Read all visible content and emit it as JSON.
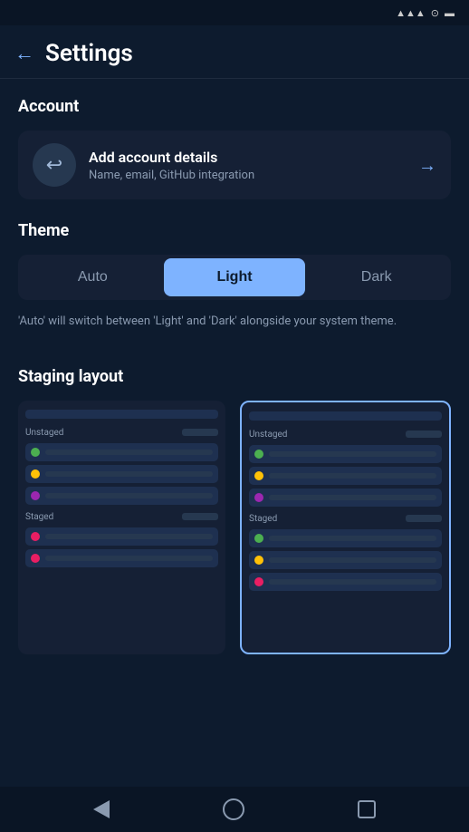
{
  "statusBar": {
    "batteryIcon": "battery-icon",
    "signalIcon": "signal-icon"
  },
  "header": {
    "backLabel": "←",
    "title": "Settings"
  },
  "account": {
    "sectionTitle": "Account",
    "card": {
      "title": "Add account details",
      "subtitle": "Name, email, GitHub integration",
      "arrow": "→"
    }
  },
  "theme": {
    "sectionTitle": "Theme",
    "options": [
      {
        "id": "auto",
        "label": "Auto",
        "active": false
      },
      {
        "id": "light",
        "label": "Light",
        "active": true
      },
      {
        "id": "dark",
        "label": "Dark",
        "active": false
      }
    ],
    "note": "'Auto' will switch between 'Light' and 'Dark' alongside your system theme."
  },
  "stagingLayout": {
    "sectionTitle": "Staging layout",
    "layouts": [
      {
        "id": "layout-1",
        "selected": false,
        "unstagedLabel": "Unstaged",
        "files": [
          {
            "color": "green"
          },
          {
            "color": "yellow"
          },
          {
            "color": "purple"
          }
        ],
        "stagedLabel": "Staged",
        "stagedFiles": [
          {
            "color": "pink"
          },
          {
            "color": "pink"
          }
        ]
      },
      {
        "id": "layout-2",
        "selected": true,
        "unstagedLabel": "Unstaged",
        "files": [
          {
            "color": "green"
          },
          {
            "color": "yellow"
          },
          {
            "color": "purple"
          }
        ],
        "stagedLabel": "Staged",
        "stagedFiles": [
          {
            "color": "green"
          },
          {
            "color": "yellow"
          },
          {
            "color": "pink"
          }
        ]
      }
    ]
  },
  "bottomNav": {
    "items": [
      "back",
      "home",
      "recents"
    ]
  }
}
